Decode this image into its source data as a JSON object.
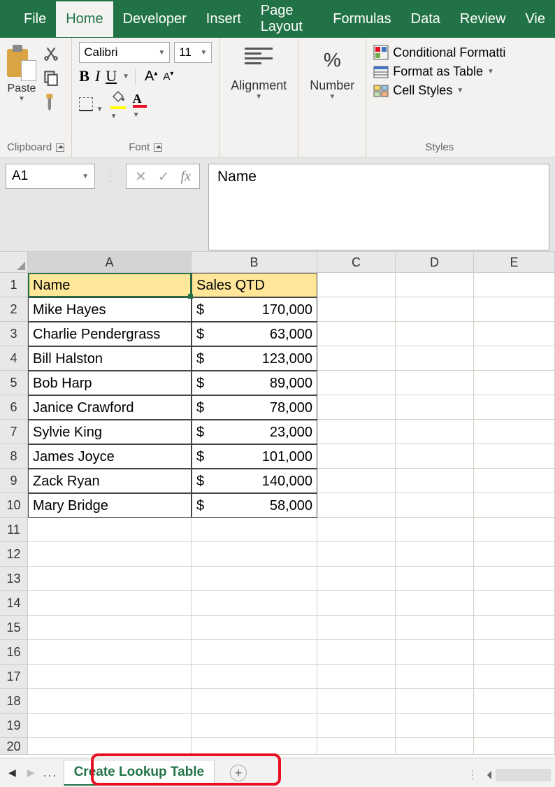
{
  "tabs": [
    "File",
    "Home",
    "Developer",
    "Insert",
    "Page Layout",
    "Formulas",
    "Data",
    "Review",
    "Vie"
  ],
  "active_tab_index": 1,
  "ribbon": {
    "clipboard": {
      "label": "Clipboard",
      "paste": "Paste"
    },
    "font": {
      "label": "Font",
      "name": "Calibri",
      "size": "11",
      "bold": "B",
      "italic": "I",
      "underline": "U",
      "grow": "A",
      "shrink": "A",
      "fontcolor_letter": "A"
    },
    "alignment": {
      "label": "Alignment"
    },
    "number": {
      "label": "Number",
      "pct": "%"
    },
    "styles": {
      "label": "Styles",
      "conditional": "Conditional Formatti",
      "table": "Format as Table",
      "cell": "Cell Styles"
    }
  },
  "formula_bar": {
    "cell_ref": "A1",
    "fx": "fx",
    "content": "Name"
  },
  "columns": [
    "A",
    "B",
    "C",
    "D",
    "E"
  ],
  "header_row": {
    "a": "Name",
    "b": "Sales QTD"
  },
  "data_rows": [
    {
      "name": "Mike Hayes",
      "sales": "170,000"
    },
    {
      "name": "Charlie Pendergrass",
      "sales": "63,000"
    },
    {
      "name": "Bill Halston",
      "sales": "123,000"
    },
    {
      "name": "Bob Harp",
      "sales": "89,000"
    },
    {
      "name": "Janice Crawford",
      "sales": "78,000"
    },
    {
      "name": "Sylvie King",
      "sales": "23,000"
    },
    {
      "name": "James Joyce",
      "sales": "101,000"
    },
    {
      "name": "Zack Ryan",
      "sales": "140,000"
    },
    {
      "name": "Mary Bridge",
      "sales": "58,000"
    }
  ],
  "currency_symbol": "$",
  "row_numbers": [
    "1",
    "2",
    "3",
    "4",
    "5",
    "6",
    "7",
    "8",
    "9",
    "10",
    "11",
    "12",
    "13",
    "14",
    "15",
    "16",
    "17",
    "18",
    "19",
    "20"
  ],
  "sheet_tab": "Create Lookup Table",
  "add_sheet": "+",
  "ellipsis": "..."
}
